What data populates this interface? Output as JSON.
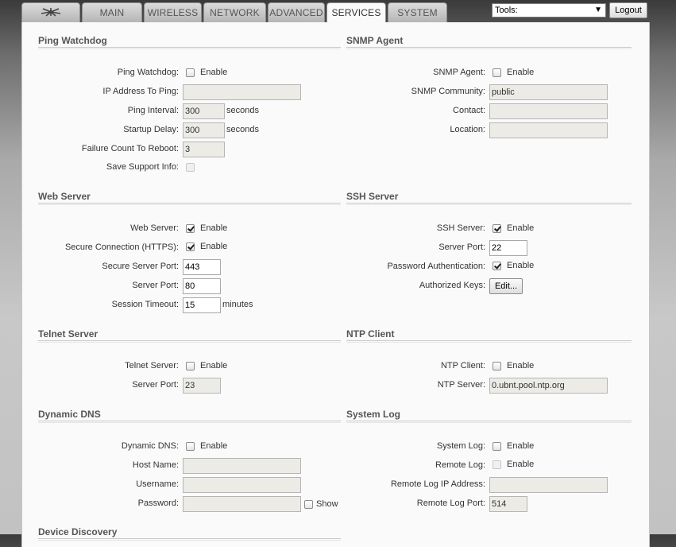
{
  "nav": {
    "tabs": [
      "MAIN",
      "WIRELESS",
      "NETWORK",
      "ADVANCED",
      "SERVICES",
      "SYSTEM"
    ],
    "active_tab": "SERVICES",
    "tools_value": "Tools:",
    "logout_label": "Logout"
  },
  "ping_watchdog": {
    "title": "Ping Watchdog",
    "enable_label": "Ping Watchdog:",
    "enable_text": "Enable",
    "ip_label": "IP Address To Ping:",
    "ip_value": "",
    "interval_label": "Ping Interval:",
    "interval_value": "300",
    "interval_unit": "seconds",
    "startup_label": "Startup Delay:",
    "startup_value": "300",
    "startup_unit": "seconds",
    "failure_label": "Failure Count To Reboot:",
    "failure_value": "3",
    "support_label": "Save Support Info:"
  },
  "snmp": {
    "title": "SNMP Agent",
    "enable_label": "SNMP Agent:",
    "enable_text": "Enable",
    "community_label": "SNMP Community:",
    "community_value": "public",
    "contact_label": "Contact:",
    "contact_value": "",
    "location_label": "Location:",
    "location_value": ""
  },
  "web_server": {
    "title": "Web Server",
    "enable_label": "Web Server:",
    "enable_text": "Enable",
    "https_label": "Secure Connection (HTTPS):",
    "https_text": "Enable",
    "secure_port_label": "Secure Server Port:",
    "secure_port_value": "443",
    "port_label": "Server Port:",
    "port_value": "80",
    "timeout_label": "Session Timeout:",
    "timeout_value": "15",
    "timeout_unit": "minutes"
  },
  "ssh": {
    "title": "SSH Server",
    "enable_label": "SSH Server:",
    "enable_text": "Enable",
    "port_label": "Server Port:",
    "port_value": "22",
    "pw_label": "Password Authentication:",
    "pw_text": "Enable",
    "keys_label": "Authorized Keys:",
    "keys_button": "Edit..."
  },
  "telnet": {
    "title": "Telnet Server",
    "enable_label": "Telnet Server:",
    "enable_text": "Enable",
    "port_label": "Server Port:",
    "port_value": "23"
  },
  "ntp": {
    "title": "NTP Client",
    "enable_label": "NTP Client:",
    "enable_text": "Enable",
    "server_label": "NTP Server:",
    "server_value": "0.ubnt.pool.ntp.org"
  },
  "ddns": {
    "title": "Dynamic DNS",
    "enable_label": "Dynamic DNS:",
    "enable_text": "Enable",
    "host_label": "Host Name:",
    "host_value": "",
    "user_label": "Username:",
    "user_value": "",
    "pass_label": "Password:",
    "pass_value": "",
    "show_text": "Show"
  },
  "syslog": {
    "title": "System Log",
    "enable_label": "System Log:",
    "enable_text": "Enable",
    "remote_label": "Remote Log:",
    "remote_text": "Enable",
    "ip_label": "Remote Log IP Address:",
    "ip_value": "",
    "port_label": "Remote Log Port:",
    "port_value": "514"
  },
  "device_discovery": {
    "title": "Device Discovery"
  }
}
